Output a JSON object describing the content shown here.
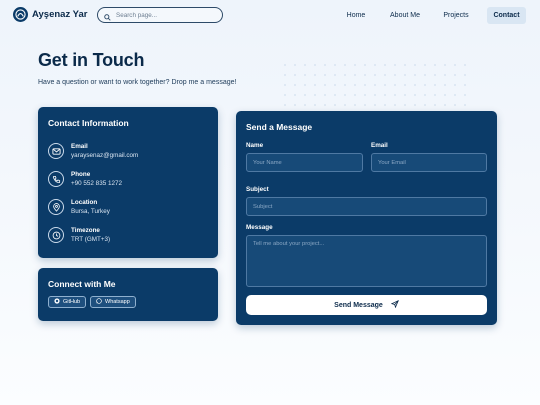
{
  "header": {
    "logo_text": "Ayşenaz Yar",
    "search_placeholder": "Search page...",
    "nav": [
      "Home",
      "About Me",
      "Projects",
      "Contact"
    ],
    "active_nav": "Contact"
  },
  "hero": {
    "title": "Get in Touch",
    "subtitle": "Have a question or want to work together? Drop me a message!"
  },
  "contact_info": {
    "title": "Contact Information",
    "items": [
      {
        "label": "Email",
        "value": "yaraysenaz@gmail.com",
        "icon": "mail-icon"
      },
      {
        "label": "Phone",
        "value": "+90 552 835 1272",
        "icon": "phone-icon"
      },
      {
        "label": "Location",
        "value": "Bursa, Turkey",
        "icon": "location-pin-icon"
      },
      {
        "label": "Timezone",
        "value": "TRT (GMT+3)",
        "icon": "clock-icon"
      }
    ]
  },
  "connect": {
    "title": "Connect with Me",
    "links": [
      {
        "label": "GitHub",
        "icon": "github-icon"
      },
      {
        "label": "Whatsapp",
        "icon": "whatsapp-icon"
      }
    ]
  },
  "form": {
    "title": "Send a Message",
    "name_label": "Name",
    "name_placeholder": "Your Name",
    "email_label": "Email",
    "email_placeholder": "Your Email",
    "subject_label": "Subject",
    "subject_placeholder": "Subject",
    "message_label": "Message",
    "message_placeholder": "Tell me about your project...",
    "submit_label": "Send Message"
  },
  "colors": {
    "primary": "#0b3b68",
    "background": "#eef4fb",
    "active_nav_bg": "#d9e6f3"
  }
}
